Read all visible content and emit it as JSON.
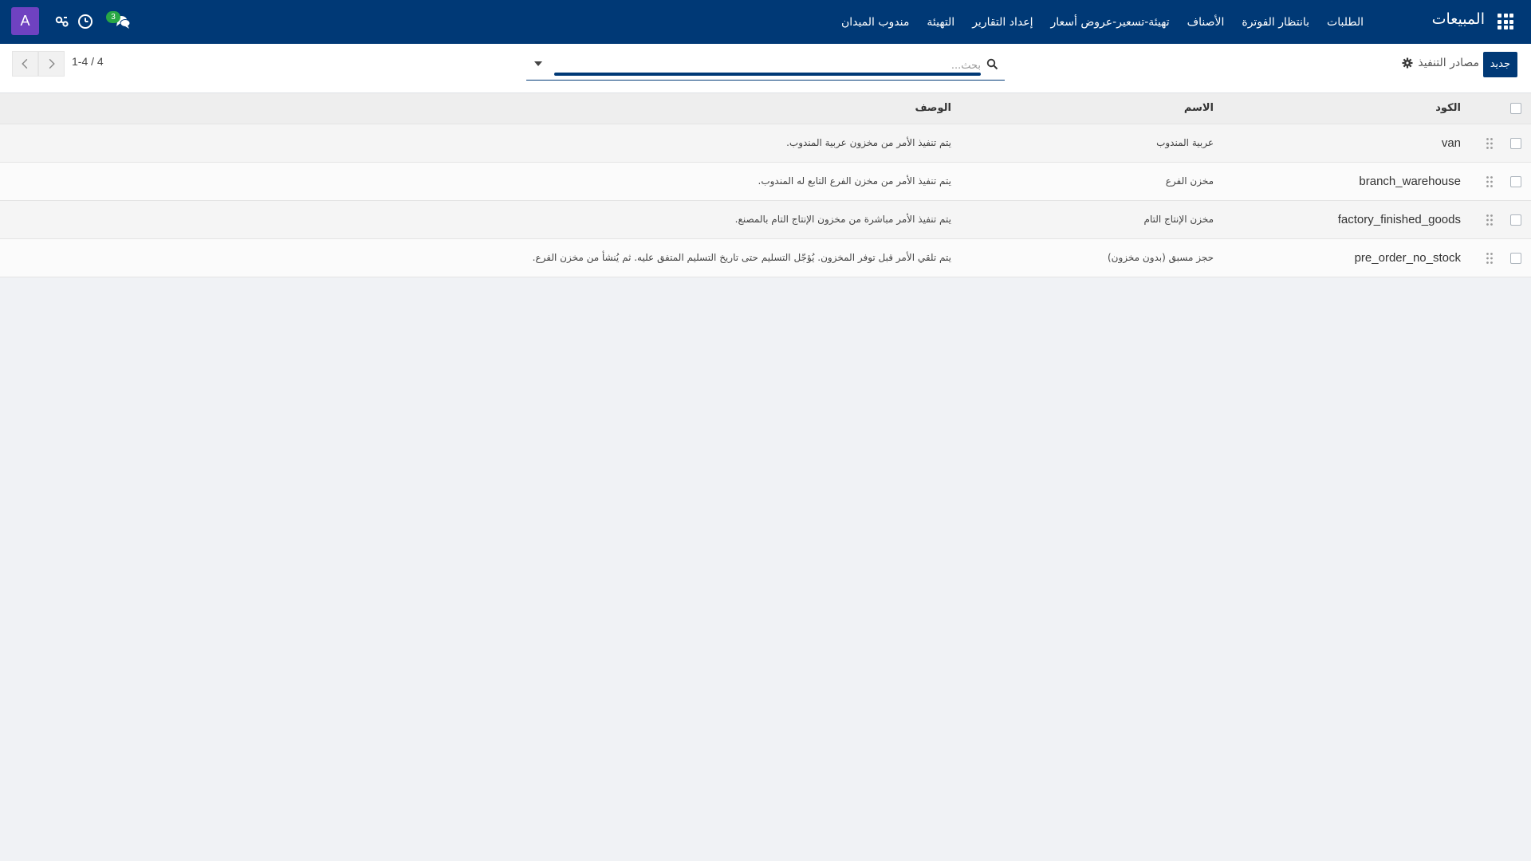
{
  "navbar": {
    "brand": "المبيعات",
    "menu": [
      {
        "label": "الطلبات"
      },
      {
        "label": "بانتظار الفوترة"
      },
      {
        "label": "الأصناف"
      },
      {
        "label": "تهيئة-تسعير-عروض أسعار"
      },
      {
        "label": "إعداد التقارير"
      },
      {
        "label": "التهيئة"
      },
      {
        "label": "مندوب الميدان"
      }
    ],
    "chat_count": "3",
    "avatar_letter": "A",
    "icons": [
      "apps-grid-icon",
      "chat-icon",
      "clock-icon",
      "tools-icon"
    ],
    "bg_color": "#003976",
    "avatar_color": "#6f42c1",
    "badge_color": "#28a745"
  },
  "control_panel": {
    "new_button": "جديد",
    "breadcrumb": "مصادر التنفيذ",
    "search_placeholder": "بحث...",
    "pager": "1-4 / 4"
  },
  "table": {
    "headers": {
      "code": "الكود",
      "name": "الاسم",
      "description": "الوصف"
    },
    "rows": [
      {
        "code": "van",
        "name": "عربية المندوب",
        "description": "يتم تنفيذ الأمر من مخزون عربية المندوب."
      },
      {
        "code": "branch_warehouse",
        "name": "مخزن الفرع",
        "description": "يتم تنفيذ الأمر من مخزن الفرع التابع له المندوب."
      },
      {
        "code": "factory_finished_goods",
        "name": "مخزن الإنتاج التام",
        "description": "يتم تنفيذ الأمر مباشرة من مخزون الإنتاج التام بالمصنع."
      },
      {
        "code": "pre_order_no_stock",
        "name": "حجز مسبق (بدون مخزون)",
        "description": "يتم تلقي الأمر قبل توفر المخزون. يُؤجّل التسليم حتى تاريخ التسليم المتفق عليه. ثم يُنشأ من مخزن الفرع."
      }
    ]
  }
}
